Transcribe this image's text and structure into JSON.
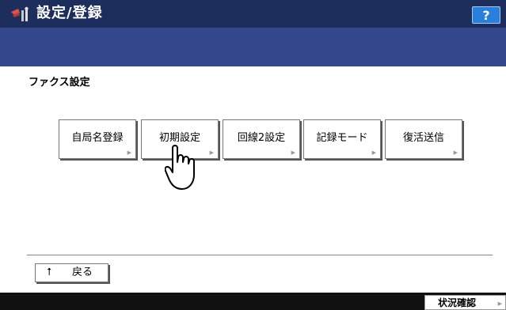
{
  "header": {
    "title": "設定/登録",
    "help_label": "?"
  },
  "page": {
    "section_title": "ファクス設定"
  },
  "menu_buttons": [
    {
      "label": "自局名登録"
    },
    {
      "label": "初期設定"
    },
    {
      "label": "回線2設定"
    },
    {
      "label": "記録モード"
    },
    {
      "label": "復活送信"
    }
  ],
  "footer": {
    "back_label": "戻る",
    "status_label": "状況確認"
  },
  "icons": {
    "app": "settings-tools-icon",
    "back": "up-arrow-icon",
    "pointer": "hand-pointer-icon",
    "button_corner": "corner-arrow-icon"
  },
  "colors": {
    "title_bar": "#1d2d5c",
    "sub_bar": "#34478c",
    "help_button": "#2b7fdc",
    "status_bar": "#111111"
  }
}
